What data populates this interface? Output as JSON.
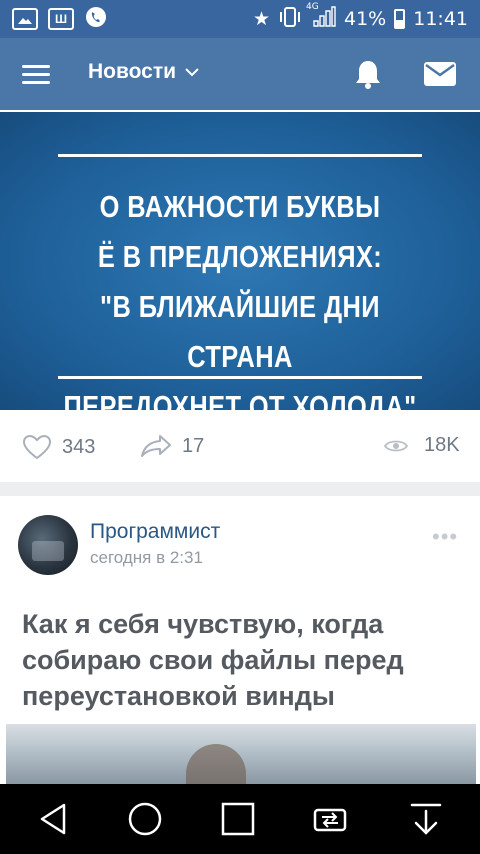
{
  "status_bar": {
    "left_icons": [
      "image-icon",
      "shazam-icon",
      "viber-icon"
    ],
    "network": "4G",
    "battery_percent": "41%",
    "battery_level": 0.41,
    "time": "11:41"
  },
  "app_bar": {
    "title": "Новости",
    "dropdown_glyph": "⌄",
    "icons": [
      "menu-icon",
      "bell-icon",
      "mail-icon"
    ]
  },
  "post1": {
    "poster_lines": [
      "О ВАЖНОСТИ БУКВЫ",
      "Ё В ПРЕДЛОЖЕНИЯХ:",
      "\"В БЛИЖАЙШИЕ ДНИ СТРАНА",
      "ПЕРЕДОХНЕТ ОТ ХОЛОДА\""
    ],
    "likes": "343",
    "shares": "17",
    "views": "18K"
  },
  "post2": {
    "author": "Программист",
    "time": "сегодня в 2:31",
    "text": "Как я себя чувствую, когда собираю свои файлы перед переустановкой винды"
  },
  "colors": {
    "app_bar": "#4a76a8",
    "status_bar": "#3a66a0",
    "poster_bg": "#1e5f98",
    "link": "#2a5885"
  }
}
